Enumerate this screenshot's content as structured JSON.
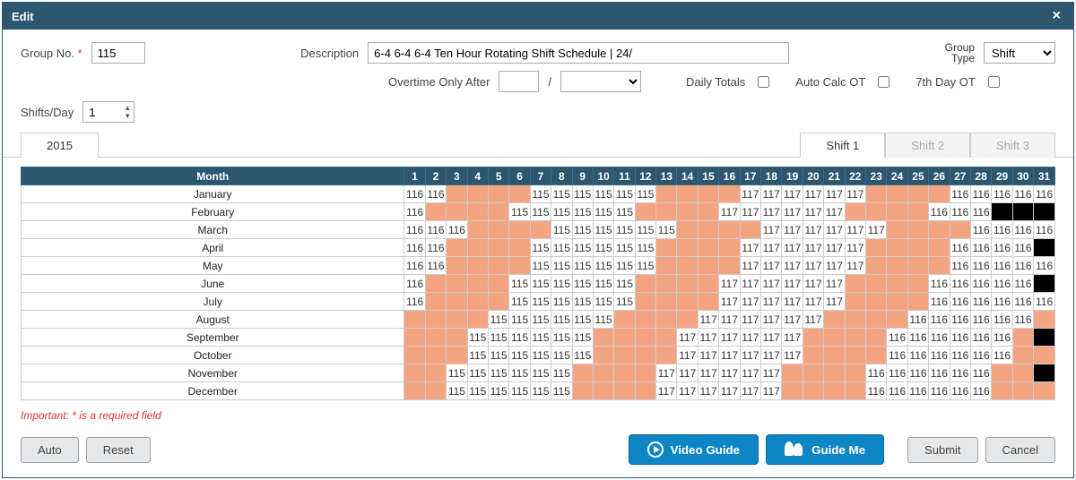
{
  "title": "Edit",
  "form": {
    "groupNoLabel": "Group No.",
    "groupNoValue": "115",
    "descriptionLabel": "Description",
    "descriptionValue": "6-4 6-4 6-4 Ten Hour Rotating Shift Schedule | 24/",
    "groupTypeLabel1": "Group",
    "groupTypeLabel2": "Type",
    "groupTypeValue": "Shift",
    "overtimeLabel": "Overtime Only After",
    "overtimeNum": "",
    "overtimeSlash": "/",
    "overtimeSel": "",
    "dailyTotalsLabel": "Daily Totals",
    "autoCalcLabel": "Auto Calc OT",
    "seventhDayLabel": "7th Day OT",
    "shiftsDayLabel": "Shifts/Day",
    "shiftsDayValue": "1"
  },
  "tabs": {
    "year": "2015",
    "shift1": "Shift 1",
    "shift2": "Shift 2",
    "shift3": "Shift 3"
  },
  "monthHeader": "Month",
  "days": [
    "1",
    "2",
    "3",
    "4",
    "5",
    "6",
    "7",
    "8",
    "9",
    "10",
    "11",
    "12",
    "13",
    "14",
    "15",
    "16",
    "17",
    "18",
    "19",
    "20",
    "21",
    "22",
    "23",
    "24",
    "25",
    "26",
    "27",
    "28",
    "29",
    "30",
    "31"
  ],
  "months": [
    {
      "name": "January",
      "cells": [
        "116",
        "116",
        "",
        "",
        "",
        "",
        "115",
        "115",
        "115",
        "115",
        "115",
        "115",
        "",
        "",
        "",
        "",
        "117",
        "117",
        "117",
        "117",
        "117",
        "117",
        "",
        "",
        "",
        "",
        "116",
        "116",
        "116",
        "116",
        "116"
      ]
    },
    {
      "name": "February",
      "cells": [
        "116",
        "",
        "",
        "",
        "",
        "115",
        "115",
        "115",
        "115",
        "115",
        "115",
        "",
        "",
        "",
        "",
        "117",
        "117",
        "117",
        "117",
        "117",
        "117",
        "",
        "",
        "",
        "",
        "116",
        "116",
        "116",
        "B",
        "B",
        "B"
      ]
    },
    {
      "name": "March",
      "cells": [
        "116",
        "116",
        "116",
        "",
        "",
        "",
        "",
        "115",
        "115",
        "115",
        "115",
        "115",
        "115",
        "",
        "",
        "",
        "",
        "117",
        "117",
        "117",
        "117",
        "117",
        "117",
        "",
        "",
        "",
        "",
        "116",
        "116",
        "116",
        "116"
      ]
    },
    {
      "name": "April",
      "cells": [
        "116",
        "116",
        "",
        "",
        "",
        "",
        "115",
        "115",
        "115",
        "115",
        "115",
        "115",
        "",
        "",
        "",
        "",
        "117",
        "117",
        "117",
        "117",
        "117",
        "117",
        "",
        "",
        "",
        "",
        "116",
        "116",
        "116",
        "116",
        "B"
      ]
    },
    {
      "name": "May",
      "cells": [
        "116",
        "116",
        "",
        "",
        "",
        "",
        "115",
        "115",
        "115",
        "115",
        "115",
        "115",
        "",
        "",
        "",
        "",
        "117",
        "117",
        "117",
        "117",
        "117",
        "117",
        "",
        "",
        "",
        "",
        "116",
        "116",
        "116",
        "116",
        "116"
      ]
    },
    {
      "name": "June",
      "cells": [
        "116",
        "",
        "",
        "",
        "",
        "115",
        "115",
        "115",
        "115",
        "115",
        "115",
        "",
        "",
        "",
        "",
        "117",
        "117",
        "117",
        "117",
        "117",
        "117",
        "",
        "",
        "",
        "",
        "116",
        "116",
        "116",
        "116",
        "116",
        "B"
      ]
    },
    {
      "name": "July",
      "cells": [
        "116",
        "",
        "",
        "",
        "",
        "115",
        "115",
        "115",
        "115",
        "115",
        "115",
        "",
        "",
        "",
        "",
        "117",
        "117",
        "117",
        "117",
        "117",
        "117",
        "",
        "",
        "",
        "",
        "116",
        "116",
        "116",
        "116",
        "116",
        "116"
      ]
    },
    {
      "name": "August",
      "cells": [
        "",
        "",
        "",
        "",
        "115",
        "115",
        "115",
        "115",
        "115",
        "115",
        "",
        "",
        "",
        "",
        "117",
        "117",
        "117",
        "117",
        "117",
        "117",
        "",
        "",
        "",
        "",
        "116",
        "116",
        "116",
        "116",
        "116",
        "116",
        ""
      ]
    },
    {
      "name": "September",
      "cells": [
        "",
        "",
        "",
        "115",
        "115",
        "115",
        "115",
        "115",
        "115",
        "",
        "",
        "",
        "",
        "117",
        "117",
        "117",
        "117",
        "117",
        "117",
        "",
        "",
        "",
        "",
        "116",
        "116",
        "116",
        "116",
        "116",
        "116",
        "",
        "B"
      ]
    },
    {
      "name": "October",
      "cells": [
        "",
        "",
        "",
        "115",
        "115",
        "115",
        "115",
        "115",
        "115",
        "",
        "",
        "",
        "",
        "117",
        "117",
        "117",
        "117",
        "117",
        "117",
        "",
        "",
        "",
        "",
        "116",
        "116",
        "116",
        "116",
        "116",
        "116",
        "",
        ""
      ]
    },
    {
      "name": "November",
      "cells": [
        "",
        "",
        "115",
        "115",
        "115",
        "115",
        "115",
        "115",
        "",
        "",
        "",
        "",
        "117",
        "117",
        "117",
        "117",
        "117",
        "117",
        "",
        "",
        "",
        "",
        "116",
        "116",
        "116",
        "116",
        "116",
        "116",
        "",
        "",
        "B"
      ]
    },
    {
      "name": "December",
      "cells": [
        "",
        "",
        "115",
        "115",
        "115",
        "115",
        "115",
        "115",
        "",
        "",
        "",
        "",
        "117",
        "117",
        "117",
        "117",
        "117",
        "117",
        "",
        "",
        "",
        "",
        "116",
        "116",
        "116",
        "116",
        "116",
        "116",
        "",
        "",
        ""
      ]
    }
  ],
  "importantNote": "Important: * is a required field",
  "buttons": {
    "auto": "Auto",
    "reset": "Reset",
    "video": "Video Guide",
    "guide": "Guide Me",
    "submit": "Submit",
    "cancel": "Cancel"
  }
}
